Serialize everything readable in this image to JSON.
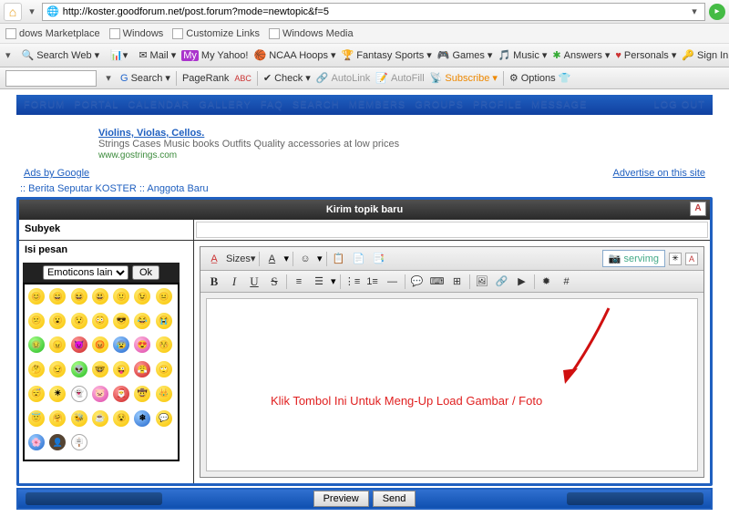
{
  "browser": {
    "url": "http://koster.goodforum.net/post.forum?mode=newtopic&f=5"
  },
  "bookmarks": [
    "dows Marketplace",
    "Windows",
    "Customize Links",
    "Windows Media"
  ],
  "toolbar": {
    "search_web": "Search Web",
    "mail": "Mail",
    "my_yahoo": "My Yahoo!",
    "ncaa": "NCAA Hoops",
    "fantasy": "Fantasy Sports",
    "games": "Games",
    "music": "Music",
    "answers": "Answers",
    "personals": "Personals",
    "signin": "Sign In"
  },
  "toolbar2": {
    "search": "Search",
    "pagerank": "PageRank",
    "check": "Check",
    "autolink": "AutoLink",
    "autofill": "AutoFill",
    "subscribe": "Subscribe",
    "options": "Options"
  },
  "nav": {
    "left": [
      "FORUM",
      "PORTAL",
      "CALENDAR",
      "GALLERY",
      "FAQ",
      "SEARCH",
      "MEMBERS",
      "GROUPS",
      "PROFILE",
      "MESSAGE"
    ],
    "right": "LOG OUT"
  },
  "ad": {
    "title": "Violins, Violas, Cellos.",
    "text": "Strings Cases Music books Outfits Quality accessories at low prices",
    "url": "www.gostrings.com",
    "ads_by": "Ads by Google",
    "advertise": "Advertise on this site"
  },
  "breadcrumb": {
    "a": "Berita Seputar KOSTER",
    "b": "Anggota Baru"
  },
  "form": {
    "title": "Kirim topik baru",
    "subyek": "Subyek",
    "isi": "Isi pesan",
    "emote_sel": "Emoticons lain",
    "ok": "Ok",
    "sizes": "Sizes",
    "servimg": "servimg",
    "overlay": "Klik Tombol Ini Untuk Meng-Up Load Gambar / Foto",
    "preview": "Preview",
    "send": "Send"
  }
}
